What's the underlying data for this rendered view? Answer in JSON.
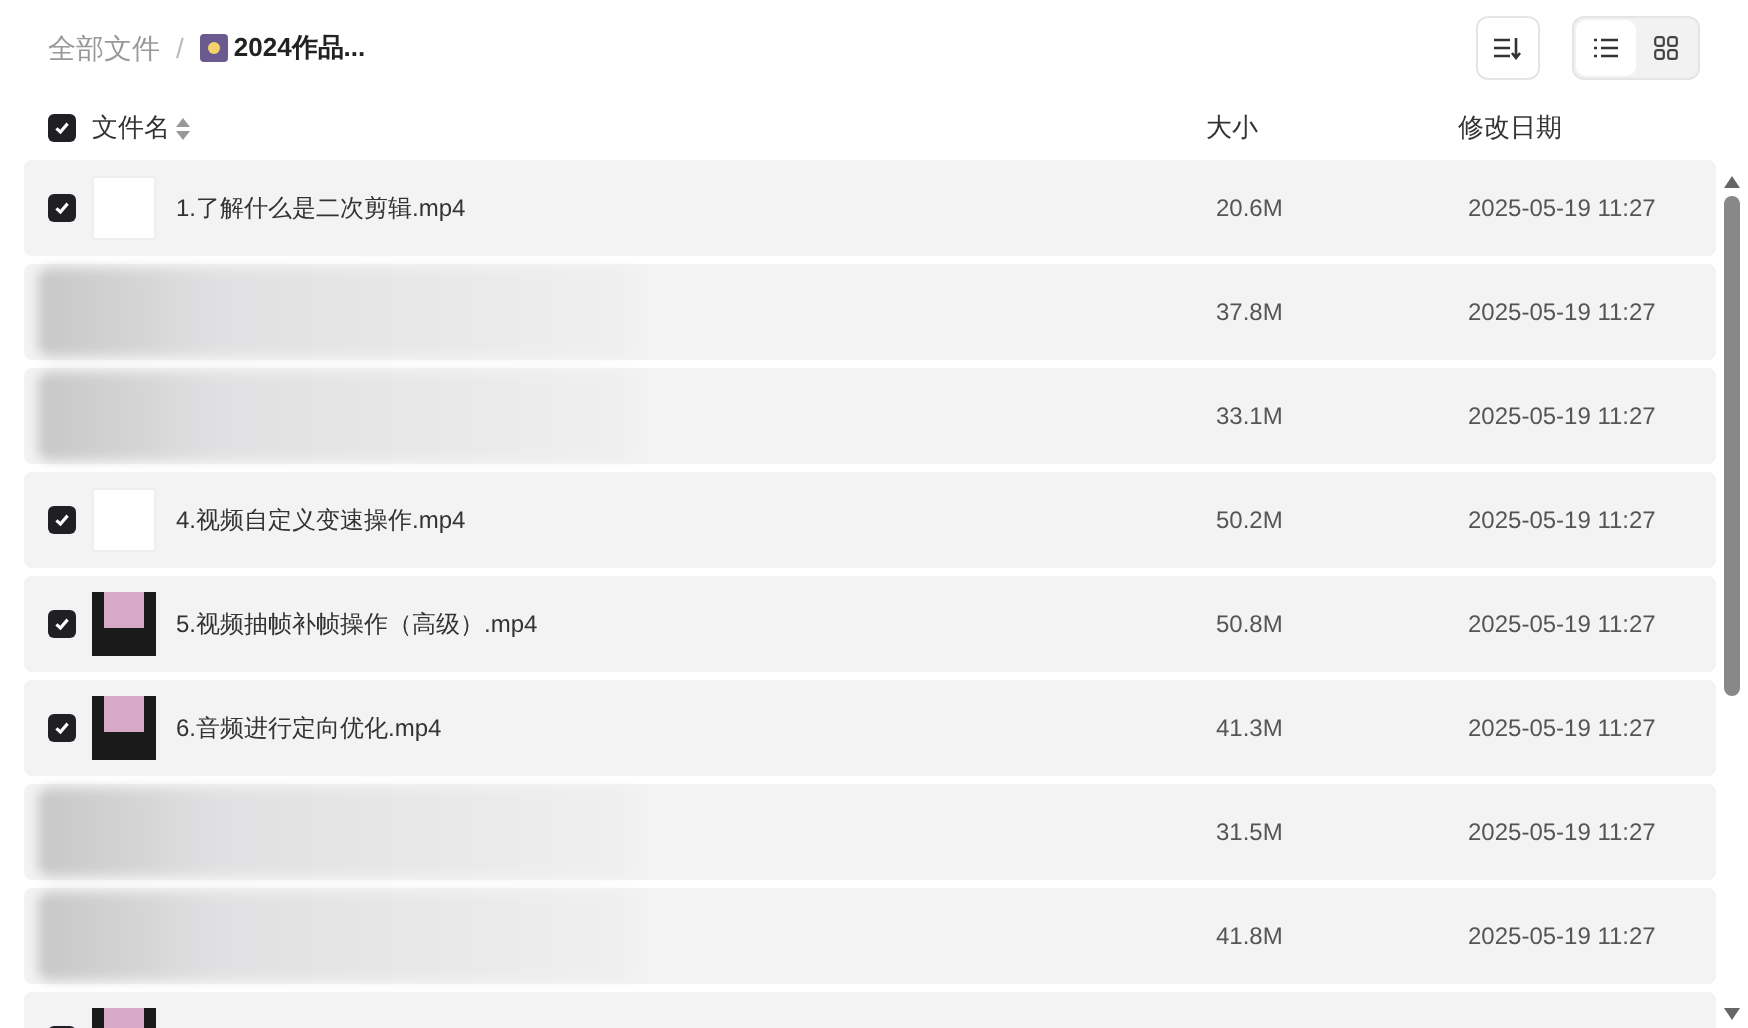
{
  "breadcrumb": {
    "root": "全部文件",
    "separator": "/",
    "current": "2024作品..."
  },
  "view_toggle": [
    {
      "kind": "list",
      "selected": true
    },
    {
      "kind": "grid",
      "selected": false
    }
  ],
  "columns": {
    "select_all": true,
    "name": "文件名",
    "size": "大小",
    "modified": "修改日期"
  },
  "rows": [
    {
      "kind": "file",
      "checked": true,
      "name": "1.了解什么是二次剪辑.mp4",
      "size": "20.6M",
      "modified": "2025-05-19 11:27"
    },
    {
      "kind": "blurred",
      "size": "37.8M",
      "modified": "2025-05-19 11:27"
    },
    {
      "kind": "blurred",
      "size": "33.1M",
      "modified": "2025-05-19 11:27"
    },
    {
      "kind": "file",
      "checked": true,
      "name": "4.视频自定义变速操作.mp4",
      "size": "50.2M",
      "modified": "2025-05-19 11:27"
    },
    {
      "kind": "file",
      "checked": true,
      "name": "5.视频抽帧补帧操作（高级）.mp4",
      "size": "50.8M",
      "modified": "2025-05-19 11:27"
    },
    {
      "kind": "file",
      "checked": true,
      "name": "6.音频进行定向优化.mp4",
      "size": "41.3M",
      "modified": "2025-05-19 11:27"
    },
    {
      "kind": "blurred",
      "size": "31.5M",
      "modified": "2025-05-19 11:27"
    },
    {
      "kind": "blurred",
      "size": "41.8M",
      "modified": "2025-05-19 11:27"
    },
    {
      "kind": "file",
      "checked": true
    }
  ]
}
